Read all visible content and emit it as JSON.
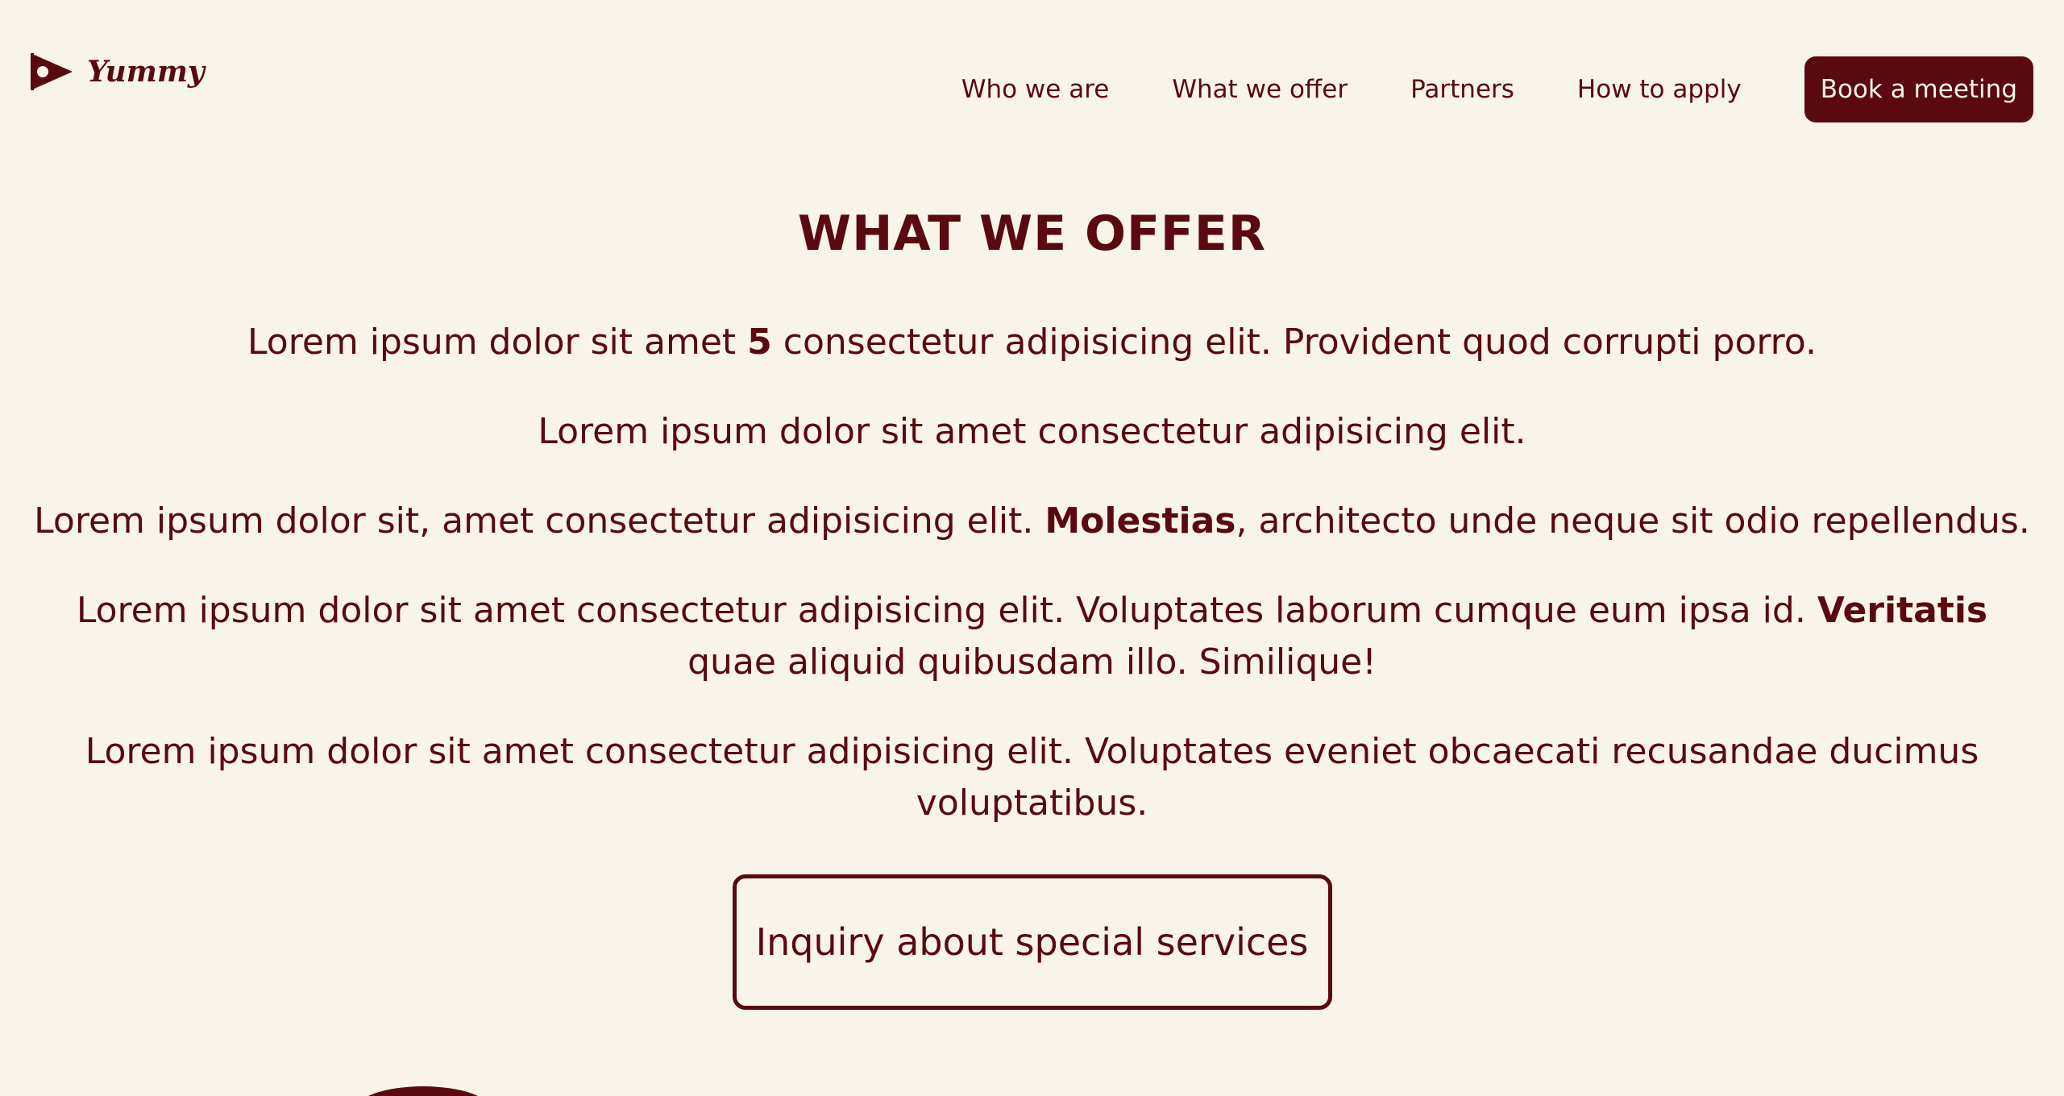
{
  "brand": {
    "name": "Yummy",
    "icon": "flag-pennant-icon"
  },
  "nav": {
    "items": [
      "Who we are",
      "What we offer",
      "Partners",
      "How to apply"
    ],
    "cta_label": "Book a meeting"
  },
  "section": {
    "title": "WHAT WE OFFER",
    "paragraphs": [
      {
        "before": "Lorem ipsum dolor sit amet ",
        "bold": "5",
        "after": " consectetur adipisicing elit. Provident quod corrupti porro."
      },
      {
        "before": "Lorem ipsum dolor sit amet consectetur adipisicing elit.",
        "bold": "",
        "after": ""
      },
      {
        "before": "Lorem ipsum dolor sit, amet consectetur adipisicing elit. ",
        "bold": "Molestias",
        "after": ", architecto unde neque sit odio repellendus."
      },
      {
        "before": "Lorem ipsum dolor sit amet consectetur adipisicing elit. Voluptates laborum cumque eum ipsa id. ",
        "bold": "Veritatis",
        "after": " quae aliquid quibusdam illo. Similique!"
      },
      {
        "before": "Lorem ipsum dolor sit amet consectetur adipisicing elit. Voluptates eveniet obcaecati recusandae ducimus voluptatibus.",
        "bold": "",
        "after": ""
      }
    ],
    "inquiry_label": "Inquiry about special services"
  },
  "colors": {
    "background": "#f8f4e8",
    "accent": "#5a0a0e"
  }
}
